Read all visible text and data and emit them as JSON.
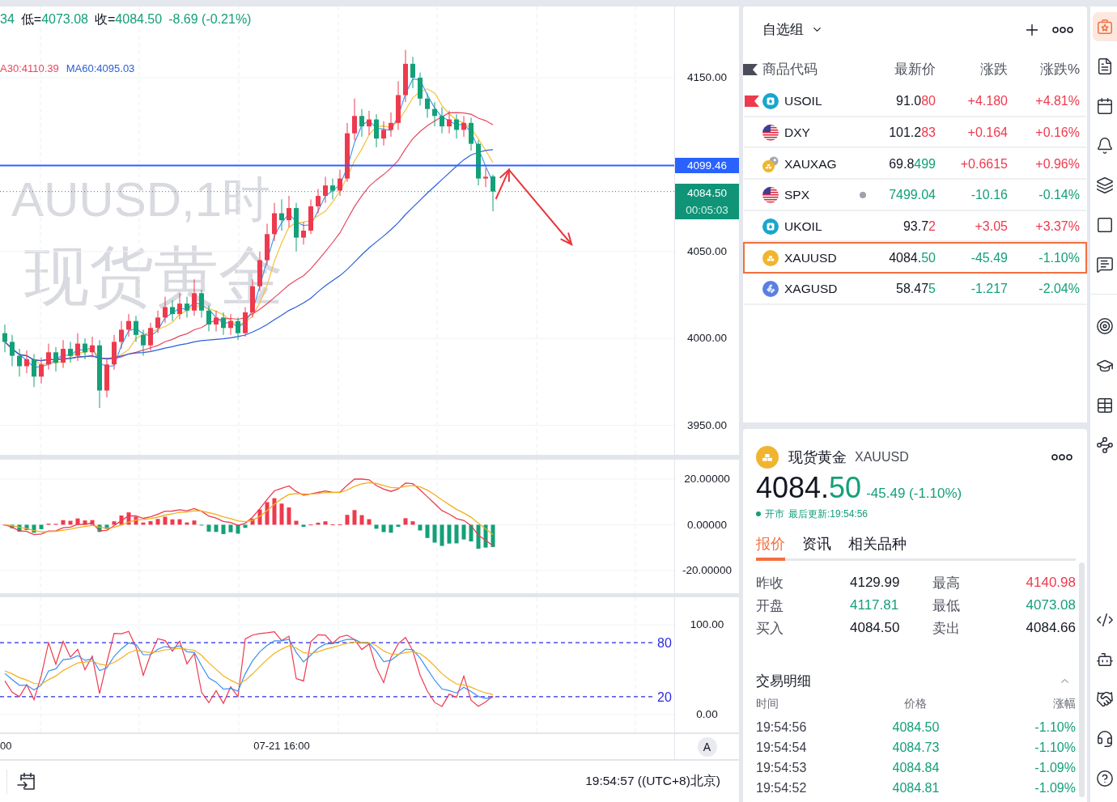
{
  "chart": {
    "legend_ohlc": [
      {
        "value": "34"
      },
      {
        "label": "低=",
        "value": "4073.08"
      },
      {
        "label": "收=",
        "value": "4084.50"
      },
      {
        "value": "-8.69 (-0.21%)"
      }
    ],
    "legend_ma": [
      {
        "text": "A30:4110.39",
        "color": "#e8475f"
      },
      {
        "text": "MA60:4095.03",
        "color": "#2b5fd9"
      }
    ],
    "watermark": [
      "AUUSD,1时",
      "现货黄金"
    ],
    "axis_labels": [
      "4150.00",
      "4050.00",
      "4000.00",
      "3950.00"
    ],
    "line_tag": "4099.46",
    "last_price": "4084.50",
    "countdown": "00:05:03"
  },
  "macd_pane": {
    "axis_labels": [
      "20.00000",
      "0.00000",
      "-20.00000"
    ]
  },
  "oscillator_pane": {
    "axis_labels": [
      "100.00",
      "0.00"
    ],
    "level_labels": [
      "80",
      "20"
    ]
  },
  "time_axis": {
    "labels": [
      "00",
      "07-21 16:00"
    ],
    "button": "A"
  },
  "status_bar": {
    "time": "19:54:57 ((UTC+8)北京)"
  },
  "watchlist": {
    "title": "自选组",
    "columns": [
      "商品代码",
      "最新价",
      "涨跌",
      "涨跌%"
    ],
    "rows": [
      {
        "kind": "energy",
        "symbol": "USOIL",
        "price_head": "91.0",
        "price_tail": "80",
        "tick_up": true,
        "change": "+4.180",
        "change_pct": "+4.81%",
        "up": true,
        "flagged": true,
        "market_closed": false,
        "selected": false
      },
      {
        "kind": "index",
        "symbol": "DXY",
        "price_head": "101.2",
        "price_tail": "83",
        "tick_up": true,
        "change": "+0.164",
        "change_pct": "+0.16%",
        "up": true,
        "flagged": false,
        "market_closed": false,
        "selected": false
      },
      {
        "kind": "cross",
        "symbol": "XAUXAG",
        "price_head": "69.8",
        "price_tail": "499",
        "tick_up": false,
        "change": "+0.6615",
        "change_pct": "+0.96%",
        "up": true,
        "flagged": false,
        "market_closed": false,
        "selected": false
      },
      {
        "kind": "index",
        "symbol": "SPX",
        "price_tail": "7499.04",
        "tick_up": false,
        "change": "-10.16",
        "change_pct": "-0.14%",
        "up": false,
        "flagged": false,
        "market_closed": true,
        "selected": false
      },
      {
        "kind": "energy",
        "symbol": "UKOIL",
        "price_head": "93.7",
        "price_tail": "2",
        "tick_up": true,
        "change": "+3.05",
        "change_pct": "+3.37%",
        "up": true,
        "flagged": false,
        "market_closed": false,
        "selected": false
      },
      {
        "kind": "gold",
        "symbol": "XAUUSD",
        "price_head": "4084.",
        "price_tail": "50",
        "tick_up": false,
        "change": "-45.49",
        "change_pct": "-1.10%",
        "up": false,
        "flagged": false,
        "market_closed": false,
        "selected": true
      },
      {
        "kind": "silver",
        "symbol": "XAGUSD",
        "price_head": "58.47",
        "price_tail": "5",
        "tick_up": false,
        "change": "-1.217",
        "change_pct": "-2.04%",
        "up": false,
        "flagged": false,
        "market_closed": false,
        "selected": false
      }
    ]
  },
  "quote": {
    "kind": "gold",
    "name": "现货黄金",
    "symbol": "XAUUSD",
    "price_head": "4084.",
    "price_tail": "50",
    "tick_up": false,
    "change": "-45.49 (-1.10%)",
    "up": false,
    "market_open": true,
    "status": "开市",
    "updated": "最后更新:19:54:56",
    "tabs": [
      {
        "label": "报价",
        "selected": true
      },
      {
        "label": "资讯",
        "selected": false
      },
      {
        "label": "相关品种",
        "selected": false
      }
    ],
    "stats": [
      {
        "label": "昨收",
        "value": "4129.99",
        "color": "#131722"
      },
      {
        "label": "最高",
        "value": "4140.98",
        "color": "#ee3a4e"
      },
      {
        "label": "开盘",
        "value": "4117.81",
        "color": "#14a079"
      },
      {
        "label": "最低",
        "value": "4073.08",
        "color": "#14a079"
      },
      {
        "label": "买入",
        "value": "4084.50",
        "color": "#131722"
      },
      {
        "label": "卖出",
        "value": "4084.66",
        "color": "#131722"
      }
    ],
    "trades": {
      "title": "交易明细",
      "expanded": true,
      "columns": [
        "时间",
        "价格",
        "涨幅"
      ],
      "rows": [
        {
          "time": "19:54:56",
          "price": "4084.50",
          "change_pct": "-1.10%",
          "up": false
        },
        {
          "time": "19:54:54",
          "price": "4084.73",
          "change_pct": "-1.10%",
          "up": false
        },
        {
          "time": "19:54:53",
          "price": "4084.84",
          "change_pct": "-1.09%",
          "up": false
        },
        {
          "time": "19:54:52",
          "price": "4084.81",
          "change_pct": "-1.09%",
          "up": false
        }
      ]
    }
  },
  "sidebar": {
    "groups": [
      {
        "items": [
          {
            "kind": "watchlist",
            "selected": true
          },
          {
            "kind": "notes",
            "selected": false
          },
          {
            "kind": "calendar",
            "selected": false
          },
          {
            "kind": "alerts",
            "selected": false
          },
          {
            "kind": "layers",
            "selected": false
          },
          {
            "kind": "window",
            "selected": false
          },
          {
            "kind": "chat",
            "selected": false
          }
        ]
      },
      {
        "items": [
          {
            "kind": "target",
            "selected": false
          },
          {
            "kind": "learn",
            "selected": false
          },
          {
            "kind": "table",
            "selected": false
          },
          {
            "kind": "network",
            "selected": false
          }
        ]
      },
      {
        "items": [
          {
            "kind": "code",
            "selected": false
          },
          {
            "kind": "bot",
            "selected": false
          },
          {
            "kind": "deal",
            "selected": false
          },
          {
            "kind": "support",
            "selected": false
          },
          {
            "kind": "help",
            "selected": false
          }
        ]
      }
    ]
  }
}
